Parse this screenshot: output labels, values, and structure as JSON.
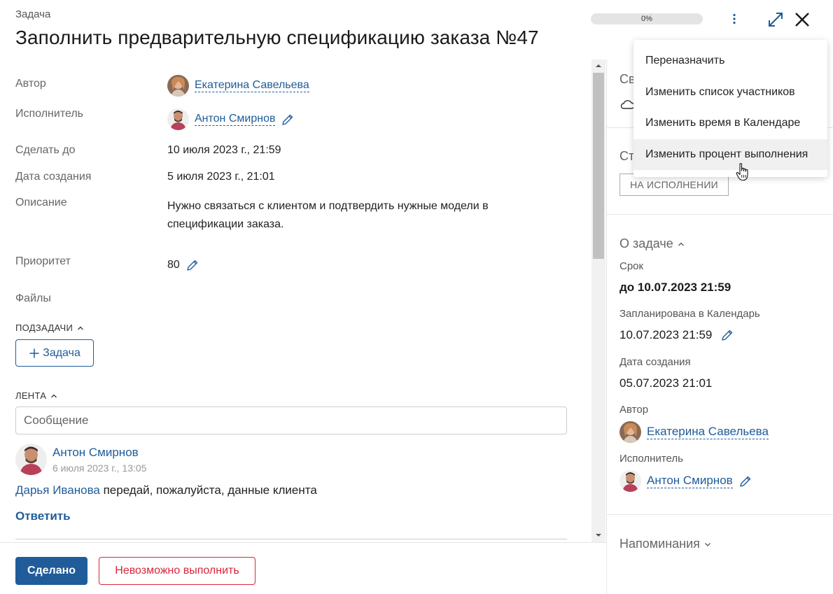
{
  "header": {
    "overtitle": "Задача",
    "title": "Заполнить предварительную спецификацию заказа №47",
    "progress": {
      "label": "0%",
      "percent": 0
    }
  },
  "fields": {
    "author_label": "Автор",
    "author_name": "Екатерина Савельева",
    "executor_label": "Исполнитель",
    "executor_name": "Антон Смирнов",
    "deadline_label": "Сделать до",
    "deadline_value": "10 июля 2023 г., 21:59",
    "created_label": "Дата создания",
    "created_value": "5 июля 2023 г., 21:01",
    "description_label": "Описание",
    "description_line1": "Нужно связаться с клиентом и подтвердить нужные модели в",
    "description_line2": "спецификации заказа.",
    "priority_label": "Приоритет",
    "priority_value": "80",
    "files_label": "Файлы"
  },
  "subtasks": {
    "heading": "ПОДЗАДАЧИ",
    "add_button": "Задача"
  },
  "feed": {
    "heading": "ЛЕНТА",
    "message_placeholder": "Сообщение",
    "comment": {
      "author": "Антон Смирнов",
      "date": "6 июля 2023 г., 13:05",
      "mention": "Дарья Иванова",
      "text": " передай, пожалуйста, данные клиента",
      "reply_label": "Ответить"
    }
  },
  "footer": {
    "done_button": "Сделано",
    "impossible_button": "Невозможно выполнить"
  },
  "right_panel": {
    "partial_top_label": "Св",
    "partial_status_label": "Ст",
    "status_badge": "НА ИСПОЛНЕНИИ",
    "about_heading": "О задаче",
    "term_label": "Срок",
    "term_value": "до 10.07.2023 21:59",
    "calendar_label": "Запланирована в Календарь",
    "calendar_value": "10.07.2023 21:59",
    "created_label": "Дата создания",
    "created_value": "05.07.2023 21:01",
    "author_label": "Автор",
    "author_name": "Екатерина Савельева",
    "executor_label": "Исполнитель",
    "executor_name": "Антон Смирнов",
    "reminders_heading": "Напоминания"
  },
  "menu": {
    "items": [
      "Переназначить",
      "Изменить список участников",
      "Изменить время в Календаре",
      "Изменить процент выполнения"
    ],
    "hovered_index": 3
  },
  "icons": {
    "more": "more-vertical-icon",
    "expand": "expand-icon",
    "close": "close-icon",
    "edit": "pencil-icon",
    "cloud": "cloud-icon"
  },
  "colors": {
    "accent": "#1f5c99",
    "danger": "#d9263a",
    "progress_track": "#e4e4e4"
  }
}
